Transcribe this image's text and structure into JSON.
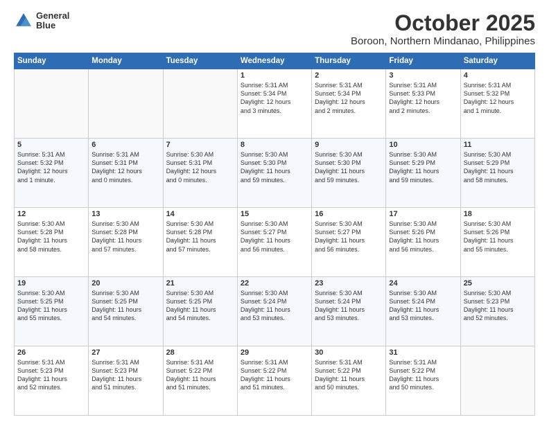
{
  "header": {
    "logo_line1": "General",
    "logo_line2": "Blue",
    "month": "October 2025",
    "location": "Boroon, Northern Mindanao, Philippines"
  },
  "days_of_week": [
    "Sunday",
    "Monday",
    "Tuesday",
    "Wednesday",
    "Thursday",
    "Friday",
    "Saturday"
  ],
  "weeks": [
    [
      {
        "day": "",
        "info": ""
      },
      {
        "day": "",
        "info": ""
      },
      {
        "day": "",
        "info": ""
      },
      {
        "day": "1",
        "info": "Sunrise: 5:31 AM\nSunset: 5:34 PM\nDaylight: 12 hours\nand 3 minutes."
      },
      {
        "day": "2",
        "info": "Sunrise: 5:31 AM\nSunset: 5:34 PM\nDaylight: 12 hours\nand 2 minutes."
      },
      {
        "day": "3",
        "info": "Sunrise: 5:31 AM\nSunset: 5:33 PM\nDaylight: 12 hours\nand 2 minutes."
      },
      {
        "day": "4",
        "info": "Sunrise: 5:31 AM\nSunset: 5:32 PM\nDaylight: 12 hours\nand 1 minute."
      }
    ],
    [
      {
        "day": "5",
        "info": "Sunrise: 5:31 AM\nSunset: 5:32 PM\nDaylight: 12 hours\nand 1 minute."
      },
      {
        "day": "6",
        "info": "Sunrise: 5:31 AM\nSunset: 5:31 PM\nDaylight: 12 hours\nand 0 minutes."
      },
      {
        "day": "7",
        "info": "Sunrise: 5:30 AM\nSunset: 5:31 PM\nDaylight: 12 hours\nand 0 minutes."
      },
      {
        "day": "8",
        "info": "Sunrise: 5:30 AM\nSunset: 5:30 PM\nDaylight: 11 hours\nand 59 minutes."
      },
      {
        "day": "9",
        "info": "Sunrise: 5:30 AM\nSunset: 5:30 PM\nDaylight: 11 hours\nand 59 minutes."
      },
      {
        "day": "10",
        "info": "Sunrise: 5:30 AM\nSunset: 5:29 PM\nDaylight: 11 hours\nand 59 minutes."
      },
      {
        "day": "11",
        "info": "Sunrise: 5:30 AM\nSunset: 5:29 PM\nDaylight: 11 hours\nand 58 minutes."
      }
    ],
    [
      {
        "day": "12",
        "info": "Sunrise: 5:30 AM\nSunset: 5:28 PM\nDaylight: 11 hours\nand 58 minutes."
      },
      {
        "day": "13",
        "info": "Sunrise: 5:30 AM\nSunset: 5:28 PM\nDaylight: 11 hours\nand 57 minutes."
      },
      {
        "day": "14",
        "info": "Sunrise: 5:30 AM\nSunset: 5:28 PM\nDaylight: 11 hours\nand 57 minutes."
      },
      {
        "day": "15",
        "info": "Sunrise: 5:30 AM\nSunset: 5:27 PM\nDaylight: 11 hours\nand 56 minutes."
      },
      {
        "day": "16",
        "info": "Sunrise: 5:30 AM\nSunset: 5:27 PM\nDaylight: 11 hours\nand 56 minutes."
      },
      {
        "day": "17",
        "info": "Sunrise: 5:30 AM\nSunset: 5:26 PM\nDaylight: 11 hours\nand 56 minutes."
      },
      {
        "day": "18",
        "info": "Sunrise: 5:30 AM\nSunset: 5:26 PM\nDaylight: 11 hours\nand 55 minutes."
      }
    ],
    [
      {
        "day": "19",
        "info": "Sunrise: 5:30 AM\nSunset: 5:25 PM\nDaylight: 11 hours\nand 55 minutes."
      },
      {
        "day": "20",
        "info": "Sunrise: 5:30 AM\nSunset: 5:25 PM\nDaylight: 11 hours\nand 54 minutes."
      },
      {
        "day": "21",
        "info": "Sunrise: 5:30 AM\nSunset: 5:25 PM\nDaylight: 11 hours\nand 54 minutes."
      },
      {
        "day": "22",
        "info": "Sunrise: 5:30 AM\nSunset: 5:24 PM\nDaylight: 11 hours\nand 53 minutes."
      },
      {
        "day": "23",
        "info": "Sunrise: 5:30 AM\nSunset: 5:24 PM\nDaylight: 11 hours\nand 53 minutes."
      },
      {
        "day": "24",
        "info": "Sunrise: 5:30 AM\nSunset: 5:24 PM\nDaylight: 11 hours\nand 53 minutes."
      },
      {
        "day": "25",
        "info": "Sunrise: 5:30 AM\nSunset: 5:23 PM\nDaylight: 11 hours\nand 52 minutes."
      }
    ],
    [
      {
        "day": "26",
        "info": "Sunrise: 5:31 AM\nSunset: 5:23 PM\nDaylight: 11 hours\nand 52 minutes."
      },
      {
        "day": "27",
        "info": "Sunrise: 5:31 AM\nSunset: 5:23 PM\nDaylight: 11 hours\nand 51 minutes."
      },
      {
        "day": "28",
        "info": "Sunrise: 5:31 AM\nSunset: 5:22 PM\nDaylight: 11 hours\nand 51 minutes."
      },
      {
        "day": "29",
        "info": "Sunrise: 5:31 AM\nSunset: 5:22 PM\nDaylight: 11 hours\nand 51 minutes."
      },
      {
        "day": "30",
        "info": "Sunrise: 5:31 AM\nSunset: 5:22 PM\nDaylight: 11 hours\nand 50 minutes."
      },
      {
        "day": "31",
        "info": "Sunrise: 5:31 AM\nSunset: 5:22 PM\nDaylight: 11 hours\nand 50 minutes."
      },
      {
        "day": "",
        "info": ""
      }
    ]
  ]
}
